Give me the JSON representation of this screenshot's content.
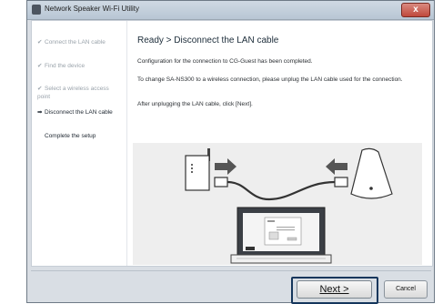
{
  "window": {
    "title": "Network Speaker Wi-Fi Utility",
    "close_label": "x"
  },
  "sidebar": {
    "steps": [
      {
        "label": "Connect the LAN cable",
        "status": "done",
        "mark": "✔"
      },
      {
        "label": "Find the device",
        "status": "done",
        "mark": "✔"
      },
      {
        "label": "Select a wireless access point",
        "status": "done",
        "mark": "✔"
      },
      {
        "label": "Disconnect the LAN cable",
        "status": "current",
        "mark": "➡"
      },
      {
        "label": "Complete the setup",
        "status": "todo",
        "mark": ""
      }
    ]
  },
  "main": {
    "heading": "Ready > Disconnect the LAN cable",
    "paragraphs": [
      "Configuration for the connection to CG-Guest has been completed.",
      "To change SA-NS300 to a wireless connection, please unplug the LAN cable used for the connection.",
      "After unplugging the LAN cable, click [Next]."
    ]
  },
  "footer": {
    "next_label": "Next >",
    "cancel_label": "Cancel"
  }
}
